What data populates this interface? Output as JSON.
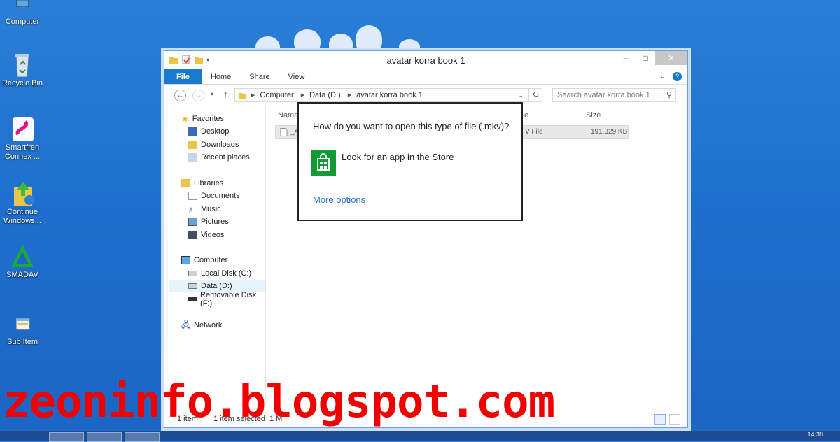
{
  "desktop": {
    "icons": [
      {
        "label": "Computer"
      },
      {
        "label": "Recycle Bin"
      },
      {
        "label": "Smartfren Connex ..."
      },
      {
        "label": "Continue Windows..."
      },
      {
        "label": "SMADAV"
      },
      {
        "label": "Sub Item"
      }
    ]
  },
  "window": {
    "title": "avatar korra book 1",
    "controls": {
      "minimize": "–",
      "maximize": "□",
      "close": "✕"
    },
    "ribbon_tabs": [
      "File",
      "Home",
      "Share",
      "View"
    ],
    "address": {
      "parts": [
        "Computer",
        "Data (D:)",
        "avatar korra book 1"
      ]
    },
    "search_placeholder": "Search avatar korra book 1",
    "nav": {
      "favorites": "Favorites",
      "favorites_items": [
        "Desktop",
        "Downloads",
        "Recent places"
      ],
      "libraries": "Libraries",
      "libraries_items": [
        "Documents",
        "Music",
        "Pictures",
        "Videos"
      ],
      "computer": "Computer",
      "computer_items": [
        "Local Disk (C:)",
        "Data (D:)",
        "Removable Disk (F:)"
      ],
      "network": "Network"
    },
    "columns": {
      "name": "Name",
      "type_suffix": "e",
      "size": "Size"
    },
    "file": {
      "name": "_A",
      "type": "V File",
      "size": "191.329 KB"
    },
    "status": {
      "items": "1 item",
      "selected": "1 item selected",
      "size": "1 M"
    }
  },
  "dialog": {
    "question": "How do you want to open this type of file (.mkv)?",
    "store_option": "Look for an app in the Store",
    "more_options": "More options"
  },
  "watermark": "zeoninfo.blogspot.com",
  "taskbar": {
    "clock": "14:38"
  },
  "colors": {
    "accent": "#1979ca",
    "store_green": "#119b36",
    "watermark": "#f00000"
  }
}
